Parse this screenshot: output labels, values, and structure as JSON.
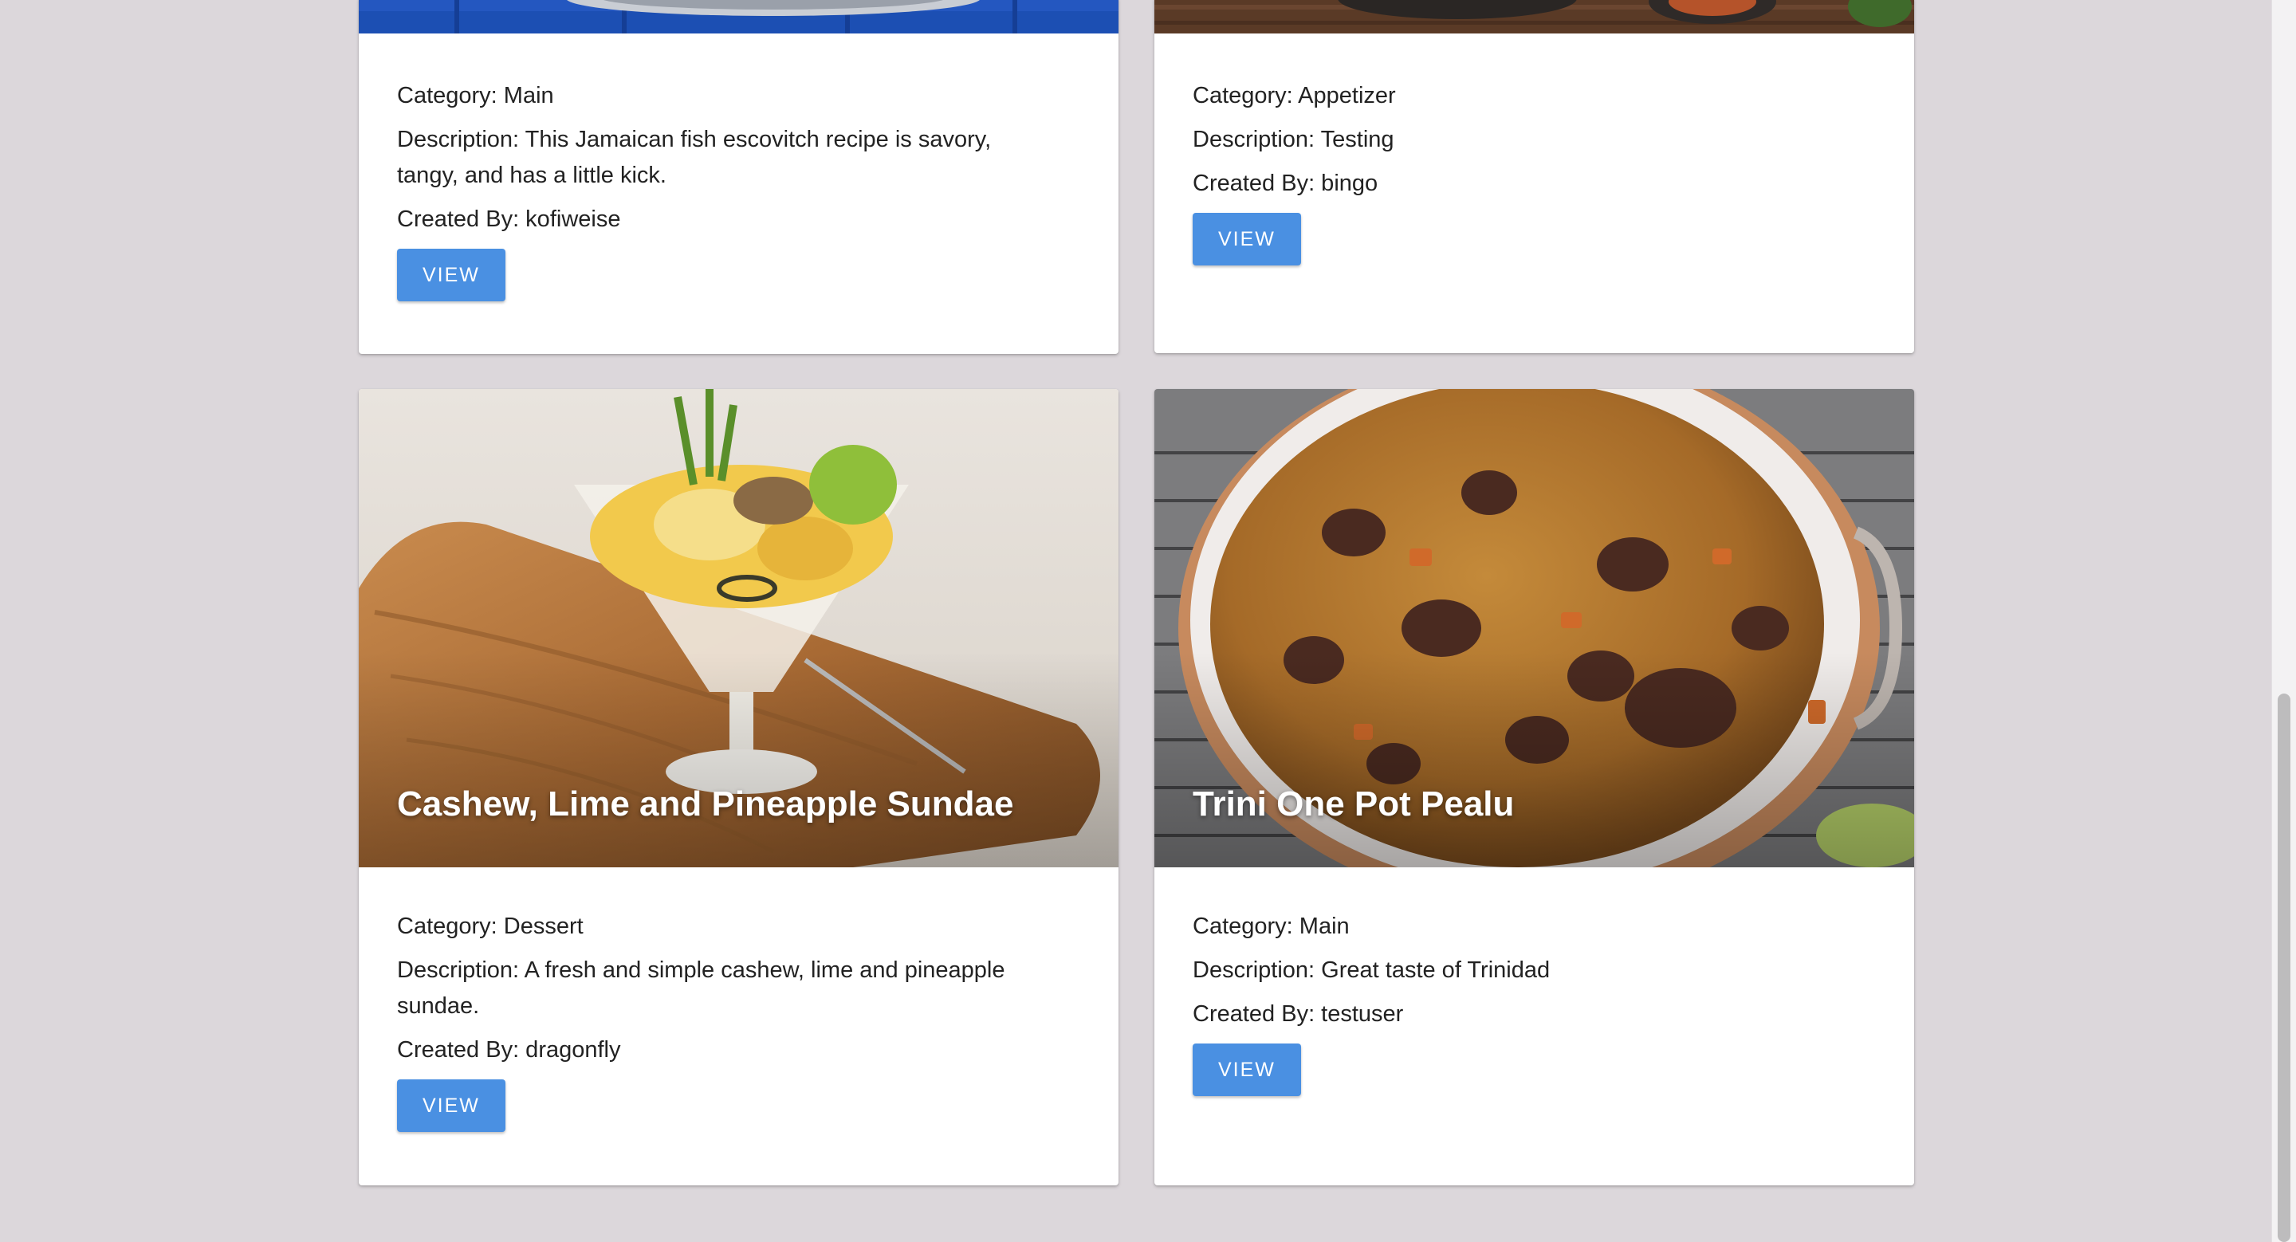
{
  "cards": [
    {
      "title": "",
      "category": "Category: Main",
      "description": "Description: This Jamaican fish escovitch recipe is savory, tangy, and has a little kick.",
      "created_by": "Created By: kofiweise",
      "button": "VIEW"
    },
    {
      "title": "",
      "category": "Category: Appetizer",
      "description": "Description: Testing",
      "created_by": "Created By: bingo",
      "button": "VIEW"
    },
    {
      "title": "Cashew, Lime and Pineapple Sundae",
      "category": "Category: Dessert",
      "description": "Description: A fresh and simple cashew, lime and pineapple sundae.",
      "created_by": "Created By: dragonfly",
      "button": "VIEW"
    },
    {
      "title": "Trini One Pot Pealu",
      "category": "Category: Main",
      "description": "Description: Great taste of Trinidad",
      "created_by": "Created By: testuser",
      "button": "VIEW"
    }
  ],
  "colors": {
    "page_background": "#dcd7db",
    "button": "#4a90e2",
    "card": "#ffffff"
  }
}
